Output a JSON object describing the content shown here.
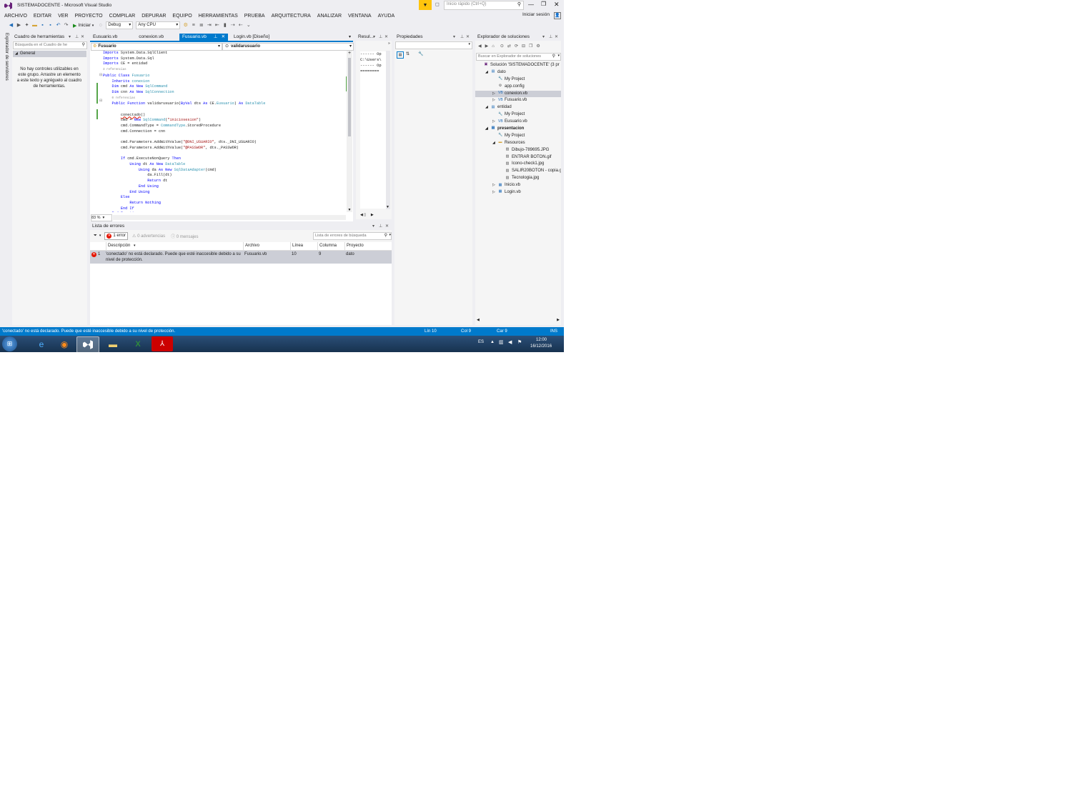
{
  "window": {
    "title": "SISTEMADOCENTE - Microsoft Visual Studio",
    "quick_launch_placeholder": "Inicio rápido (Ctrl+Q)",
    "sign_in": "Iniciar sesión"
  },
  "menu": [
    "ARCHIVO",
    "EDITAR",
    "VER",
    "PROYECTO",
    "COMPILAR",
    "DEPURAR",
    "EQUIPO",
    "HERRAMIENTAS",
    "PRUEBA",
    "ARQUITECTURA",
    "ANALIZAR",
    "VENTANA",
    "AYUDA"
  ],
  "toolbar": {
    "start_label": "Iniciar",
    "config": "Debug",
    "platform": "Any CPU"
  },
  "server_explorer": "Explorador de servidores",
  "toolbox": {
    "title": "Cuadro de herramientas",
    "search_placeholder": "Búsqueda en el Cuadro de he",
    "group": "General",
    "empty_message": "No hay controles utilizables en este grupo. Arrastre un elemento a este texto y agréguelo al cuadro de herramientas."
  },
  "editor": {
    "tabs": [
      {
        "label": "Eusuario.vb",
        "active": false
      },
      {
        "label": "conexion.vb",
        "active": false
      },
      {
        "label": "Fusuario.vb",
        "active": true
      },
      {
        "label": "Login.vb [Diseño]",
        "active": false
      }
    ],
    "class_dropdown": "Fusuario",
    "method_dropdown": "validarusuario",
    "zoom": "83 %"
  },
  "output": {
    "title": "Resul...",
    "lines": [
      "------ Op",
      "C:\\Users\\",
      "------ Op",
      "========"
    ]
  },
  "properties": {
    "title": "Propiedades"
  },
  "solution_explorer": {
    "title": "Explorador de soluciones",
    "search_placeholder": "Buscar en Explorador de soluciones",
    "items": [
      {
        "label": "Solución 'SISTEMADOCENTE' (3 pr",
        "indent": 0,
        "bold": false,
        "expander": "",
        "icon": "solution-icon"
      },
      {
        "label": "dato",
        "indent": 1,
        "bold": false,
        "expander": "◢",
        "icon": "vb-project-icon"
      },
      {
        "label": "My Project",
        "indent": 2,
        "bold": false,
        "expander": "",
        "icon": "wrench-icon"
      },
      {
        "label": "app.config",
        "indent": 2,
        "bold": false,
        "expander": "",
        "icon": "config-icon"
      },
      {
        "label": "conexion.vb",
        "indent": 2,
        "bold": false,
        "expander": "▷",
        "icon": "vb-file-icon",
        "selected": true
      },
      {
        "label": "Fusuario.vb",
        "indent": 2,
        "bold": false,
        "expander": "▷",
        "icon": "vb-file-icon"
      },
      {
        "label": "entidad",
        "indent": 1,
        "bold": false,
        "expander": "◢",
        "icon": "vb-project-icon"
      },
      {
        "label": "My Project",
        "indent": 2,
        "bold": false,
        "expander": "",
        "icon": "wrench-icon"
      },
      {
        "label": "Eusuario.vb",
        "indent": 2,
        "bold": false,
        "expander": "▷",
        "icon": "vb-file-icon"
      },
      {
        "label": "presentacion",
        "indent": 1,
        "bold": true,
        "expander": "◢",
        "icon": "vb-project-icon"
      },
      {
        "label": "My Project",
        "indent": 2,
        "bold": false,
        "expander": "",
        "icon": "wrench-icon"
      },
      {
        "label": "Resources",
        "indent": 2,
        "bold": false,
        "expander": "◢",
        "icon": "folder-icon"
      },
      {
        "label": "Dibujo-789695.JPG",
        "indent": 3,
        "bold": false,
        "expander": "",
        "icon": "image-icon"
      },
      {
        "label": "ENTRAR BOTON.gif",
        "indent": 3,
        "bold": false,
        "expander": "",
        "icon": "image-icon"
      },
      {
        "label": "Icono-check1.jpg",
        "indent": 3,
        "bold": false,
        "expander": "",
        "icon": "image-icon"
      },
      {
        "label": "SALIR20BOTON - copia.g",
        "indent": 3,
        "bold": false,
        "expander": "",
        "icon": "image-icon"
      },
      {
        "label": "Tecnologia.jpg",
        "indent": 3,
        "bold": false,
        "expander": "",
        "icon": "image-icon"
      },
      {
        "label": "Inicio.vb",
        "indent": 2,
        "bold": false,
        "expander": "▷",
        "icon": "form-icon"
      },
      {
        "label": "Login.vb",
        "indent": 2,
        "bold": false,
        "expander": "▷",
        "icon": "form-icon"
      }
    ]
  },
  "error_list": {
    "title": "Lista de errores",
    "errors_btn": "1 error",
    "warnings_btn": "0 advertencias",
    "messages_btn": "0 mensajes",
    "search_placeholder": "Lista de errores de búsqueda",
    "columns": [
      "Descripción",
      "Archivo",
      "Línea",
      "Columna",
      "Proyecto"
    ],
    "rows": [
      {
        "num": "1",
        "description": "'conectado' no está declarado. Puede que esté inaccesible debido a su nivel de protección.",
        "file": "Fusuario.vb",
        "line": "10",
        "column": "9",
        "project": "dato"
      }
    ]
  },
  "statusbar": {
    "message": "'conectado' no está declarado. Puede que esté inaccesible debido a su nivel de protección.",
    "line": "Lín 10",
    "col": "Col 9",
    "car": "Car 9",
    "ins": "INS"
  },
  "taskbar": {
    "lang": "ES",
    "time": "12:00",
    "date": "16/12/2016"
  },
  "colors": {
    "accent": "#007acc",
    "keyword": "#0000ff",
    "type": "#2b91af",
    "string": "#a31515",
    "error": "#e51400"
  }
}
